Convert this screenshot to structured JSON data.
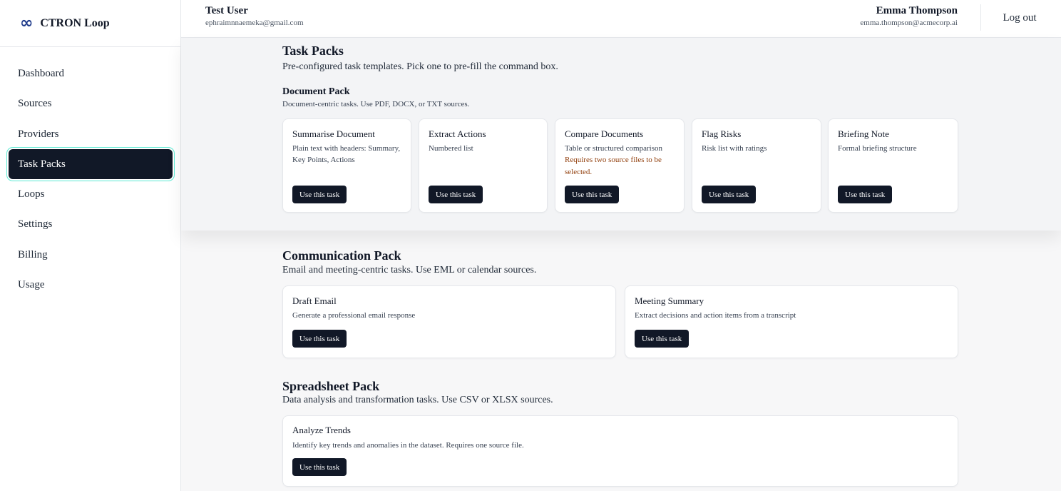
{
  "app": {
    "brand_icon": "infinity-icon",
    "brand_glyph": "∞",
    "brand_name": "CTRON Loop",
    "accent": "#111827",
    "focus_ring": "#5eead4"
  },
  "sidebar": {
    "items": [
      {
        "label": "Dashboard"
      },
      {
        "label": "Sources"
      },
      {
        "label": "Providers"
      },
      {
        "label": "Task Packs",
        "active": true
      },
      {
        "label": "Loops"
      },
      {
        "label": "Settings"
      },
      {
        "label": "Billing"
      },
      {
        "label": "Usage"
      }
    ]
  },
  "header": {
    "left_user": {
      "name": "Test User",
      "email": "ephraimnnaemeka@gmail.com"
    },
    "right_user": {
      "name": "Emma Thompson",
      "email": "emma.thompson@acmecorp.ai"
    },
    "logout_label": "Log out"
  },
  "main": {
    "title": "Task Packs",
    "description": "Pre-configured task templates. Pick one to pre-fill the command box.",
    "packs": [
      {
        "title": "Document Pack",
        "description": "Document-centric tasks. Use PDF, DOCX, or TXT sources.",
        "tasks": [
          {
            "title": "Summarise Document",
            "description": "Plain text with headers: Summary, Key Points, Actions",
            "button": "Use this task"
          },
          {
            "title": "Extract Actions",
            "description": "Numbered list",
            "button": "Use this task"
          },
          {
            "title": "Compare Documents",
            "description": "Table or structured comparison",
            "warning": "Requires two source files to be selected.",
            "button": "Use this task"
          },
          {
            "title": "Flag Risks",
            "description": "Risk list with ratings",
            "button": "Use this task"
          },
          {
            "title": "Briefing Note",
            "description": "Formal briefing structure",
            "button": "Use this task"
          }
        ]
      },
      {
        "title": "Communication Pack",
        "description": "Email and meeting-centric tasks. Use EML or calendar sources.",
        "tasks": [
          {
            "title": "Draft Email",
            "description": "Generate a professional email response",
            "button": "Use this task"
          },
          {
            "title": "Meeting Summary",
            "description": "Extract decisions and action items from a transcript",
            "button": "Use this task"
          }
        ]
      },
      {
        "title": "Spreadsheet Pack",
        "description": "Data analysis and transformation tasks. Use CSV or XLSX sources.",
        "tasks": [
          {
            "title": "Analyze Trends",
            "description": "Identify key trends and anomalies in the dataset. Requires one source file.",
            "button": "Use this task"
          }
        ]
      }
    ]
  }
}
